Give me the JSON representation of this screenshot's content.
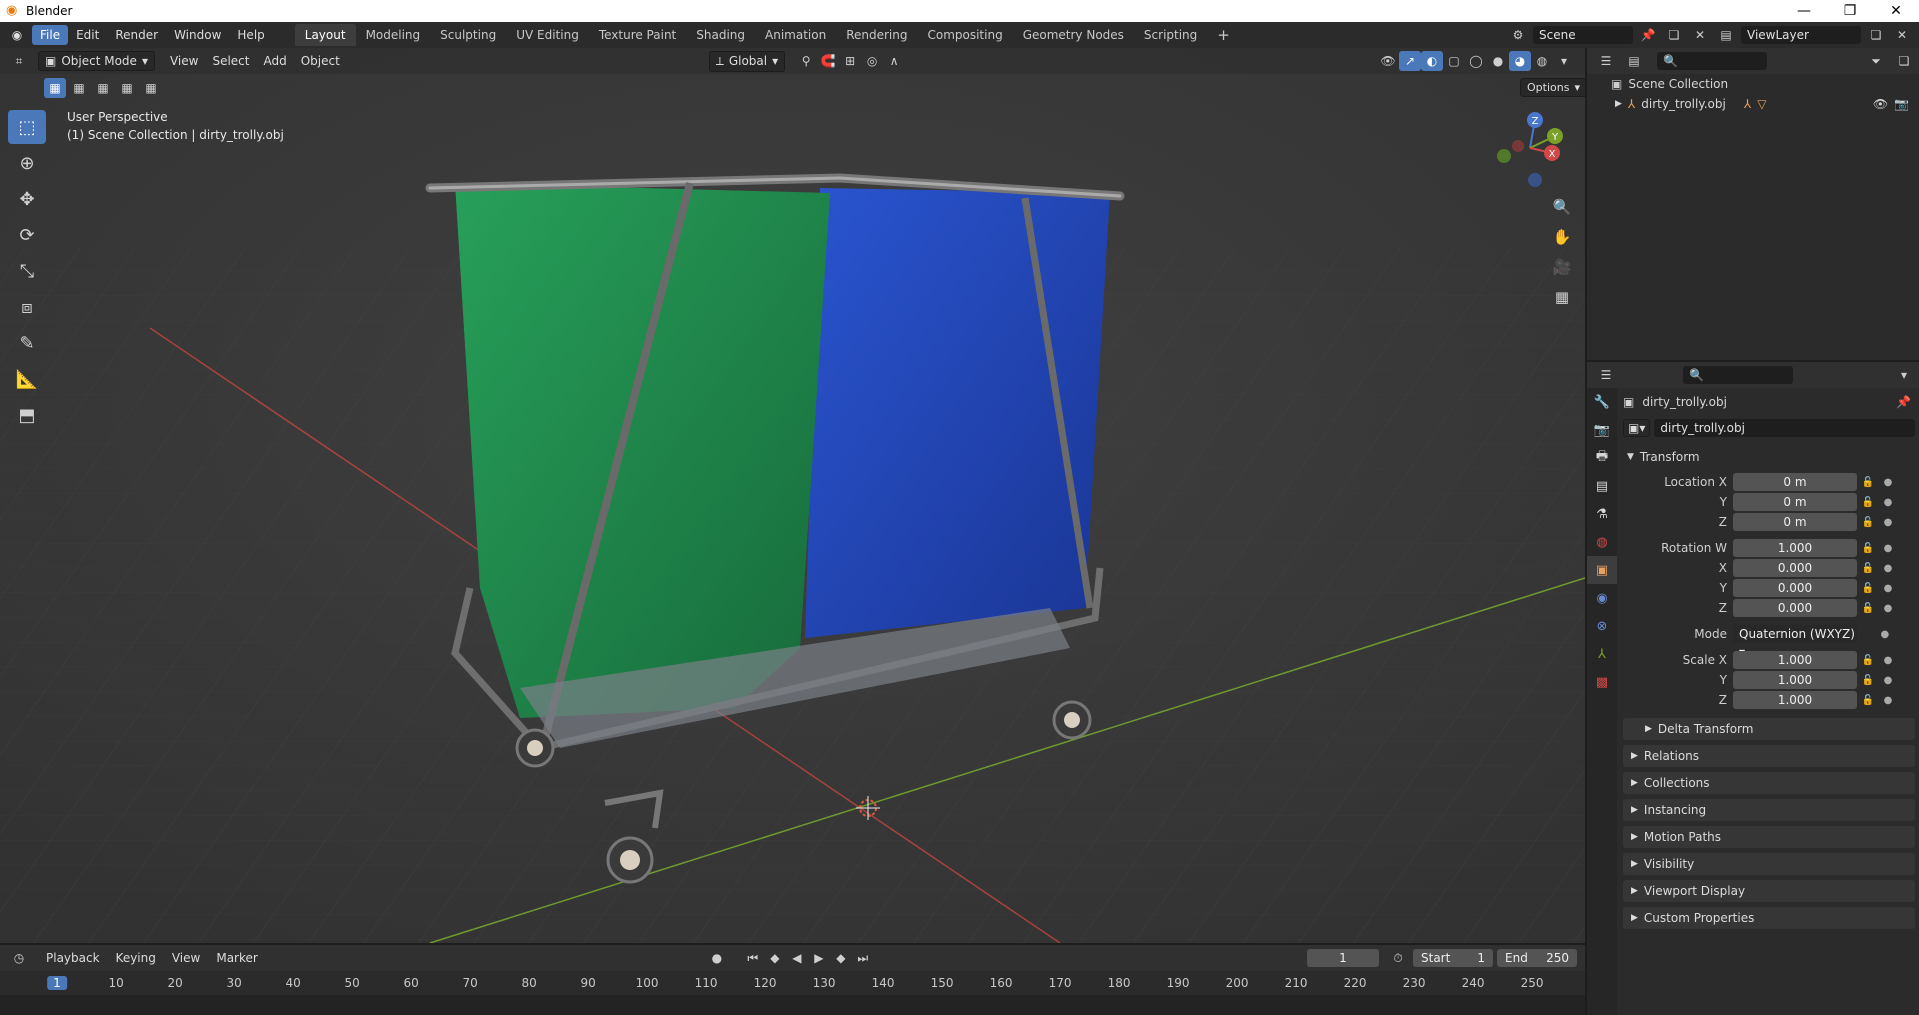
{
  "window": {
    "title": "Blender"
  },
  "menus": [
    "File",
    "Edit",
    "Render",
    "Window",
    "Help"
  ],
  "workspaces": [
    "Layout",
    "Modeling",
    "Sculpting",
    "UV Editing",
    "Texture Paint",
    "Shading",
    "Animation",
    "Rendering",
    "Compositing",
    "Geometry Nodes",
    "Scripting"
  ],
  "scene": {
    "name": "Scene",
    "view_layer": "ViewLayer"
  },
  "viewport": {
    "mode": "Object Mode",
    "menus": [
      "View",
      "Select",
      "Add",
      "Object"
    ],
    "transform_orientation": "Global",
    "options_label": "Options",
    "info_line1": "User Perspective",
    "info_line2": "(1) Scene Collection | dirty_trolly.obj"
  },
  "gizmo": {
    "z": "Z",
    "y": "Y",
    "x": "X"
  },
  "outliner": {
    "collection": "Scene Collection",
    "object": "dirty_trolly.obj"
  },
  "properties": {
    "object_name": "dirty_trolly.obj",
    "object_field": "dirty_trolly.obj",
    "transform_title": "Transform",
    "location_label": "Location X",
    "location": [
      "0 m",
      "0 m",
      "0 m"
    ],
    "rotation_label": "Rotation W",
    "rotation": [
      "1.000",
      "0.000",
      "0.000",
      "0.000"
    ],
    "mode_label": "Mode",
    "mode_value": "Quaternion (WXYZ)",
    "scale_label": "Scale X",
    "scale": [
      "1.000",
      "1.000",
      "1.000"
    ],
    "axis_y": "Y",
    "axis_z": "Z",
    "axis_x": "X",
    "delta_transform": "Delta Transform",
    "panels": [
      "Relations",
      "Collections",
      "Instancing",
      "Motion Paths",
      "Visibility",
      "Viewport Display",
      "Custom Properties"
    ]
  },
  "timeline": {
    "menus": [
      "Playback",
      "Keying",
      "View",
      "Marker"
    ],
    "current_frame": "1",
    "start_label": "Start",
    "start": "1",
    "end_label": "End",
    "end": "250",
    "ticks": [
      "1",
      "10",
      "20",
      "30",
      "40",
      "50",
      "60",
      "70",
      "80",
      "90",
      "100",
      "110",
      "120",
      "130",
      "140",
      "150",
      "160",
      "170",
      "180",
      "190",
      "200",
      "210",
      "220",
      "230",
      "240",
      "250"
    ]
  },
  "colors": {
    "accent": "#4a78b8",
    "bag_green": "#1f8a4c",
    "bag_blue": "#1f45b8",
    "x_axis": "#b8443e",
    "y_axis": "#6e9a2e"
  }
}
